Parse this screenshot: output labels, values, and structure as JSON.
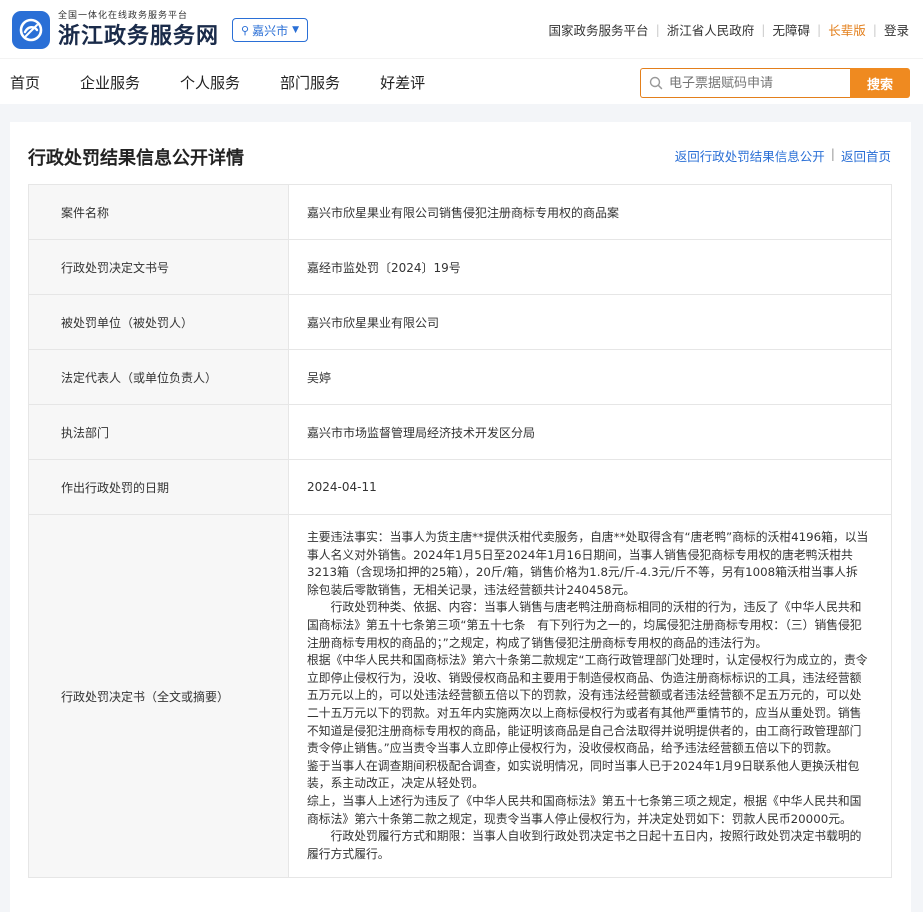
{
  "header": {
    "logo_sub": "全国一体化在线政务服务平台",
    "logo_main": "浙江政务服务网",
    "city": "嘉兴市",
    "links": [
      "国家政务服务平台",
      "浙江省人民政府",
      "无障碍",
      "长辈版",
      "登录"
    ]
  },
  "nav": {
    "items": [
      "首页",
      "企业服务",
      "个人服务",
      "部门服务",
      "好差评"
    ],
    "search_placeholder": "电子票据赋码申请",
    "search_button": "搜索"
  },
  "page": {
    "title": "行政处罚结果信息公开详情",
    "link_back_list": "返回行政处罚结果信息公开",
    "link_home": "返回首页"
  },
  "details": [
    {
      "label": "案件名称",
      "value": "嘉兴市欣星果业有限公司销售侵犯注册商标专用权的商品案"
    },
    {
      "label": "行政处罚决定文书号",
      "value": "嘉经市监处罚〔2024〕19号"
    },
    {
      "label": "被处罚单位（被处罚人）",
      "value": "嘉兴市欣星果业有限公司"
    },
    {
      "label": "法定代表人（或单位负责人）",
      "value": "吴婷"
    },
    {
      "label": "执法部门",
      "value": "嘉兴市市场监督管理局经济技术开发区分局"
    },
    {
      "label": "作出行政处罚的日期",
      "value": "2024-04-11"
    }
  ],
  "decision": {
    "label": "行政处罚决定书（全文或摘要）",
    "paragraphs": [
      "主要违法事实：当事人为货主唐**提供沃柑代卖服务，自唐**处取得含有“唐老鸭”商标的沃柑4196箱，以当事人名义对外销售。2024年1月5日至2024年1月16日期间，当事人销售侵犯商标专用权的唐老鸭沃柑共3213箱（含现场扣押的25箱），20斤/箱，销售价格为1.8元/斤-4.3元/斤不等，另有1008箱沃柑当事人拆除包装后零散销售，无相关记录，违法经营额共计240458元。",
      "　　行政处罚种类、依据、内容：当事人销售与唐老鸭注册商标相同的沃柑的行为，违反了《中华人民共和国商标法》第五十七条第三项“第五十七条　有下列行为之一的，均属侵犯注册商标专用权：（三）销售侵犯注册商标专用权的商品的；”之规定，构成了销售侵犯注册商标专用权的商品的违法行为。",
      "根据《中华人民共和国商标法》第六十条第二款规定“工商行政管理部门处理时，认定侵权行为成立的，责令立即停止侵权行为，没收、销毁侵权商品和主要用于制造侵权商品、伪造注册商标标识的工具，违法经营额五万元以上的，可以处违法经营额五倍以下的罚款，没有违法经营额或者违法经营额不足五万元的，可以处二十五万元以下的罚款。对五年内实施两次以上商标侵权行为或者有其他严重情节的，应当从重处罚。销售不知道是侵犯注册商标专用权的商品，能证明该商品是自己合法取得并说明提供者的，由工商行政管理部门责令停止销售。”应当责令当事人立即停止侵权行为，没收侵权商品，给予违法经营额五倍以下的罚款。",
      "鉴于当事人在调查期间积极配合调查，如实说明情况，同时当事人已于2024年1月9日联系他人更换沃柑包装，系主动改正，决定从轻处罚。",
      "综上，当事人上述行为违反了《中华人民共和国商标法》第五十七条第三项之规定，根据《中华人民共和国商标法》第六十条第二款之规定，现责令当事人停止侵权行为，并决定处罚如下：罚款人民币20000元。",
      "　　行政处罚履行方式和期限：当事人自收到行政处罚决定书之日起十五日内，按照行政处罚决定书载明的履行方式履行。"
    ]
  }
}
